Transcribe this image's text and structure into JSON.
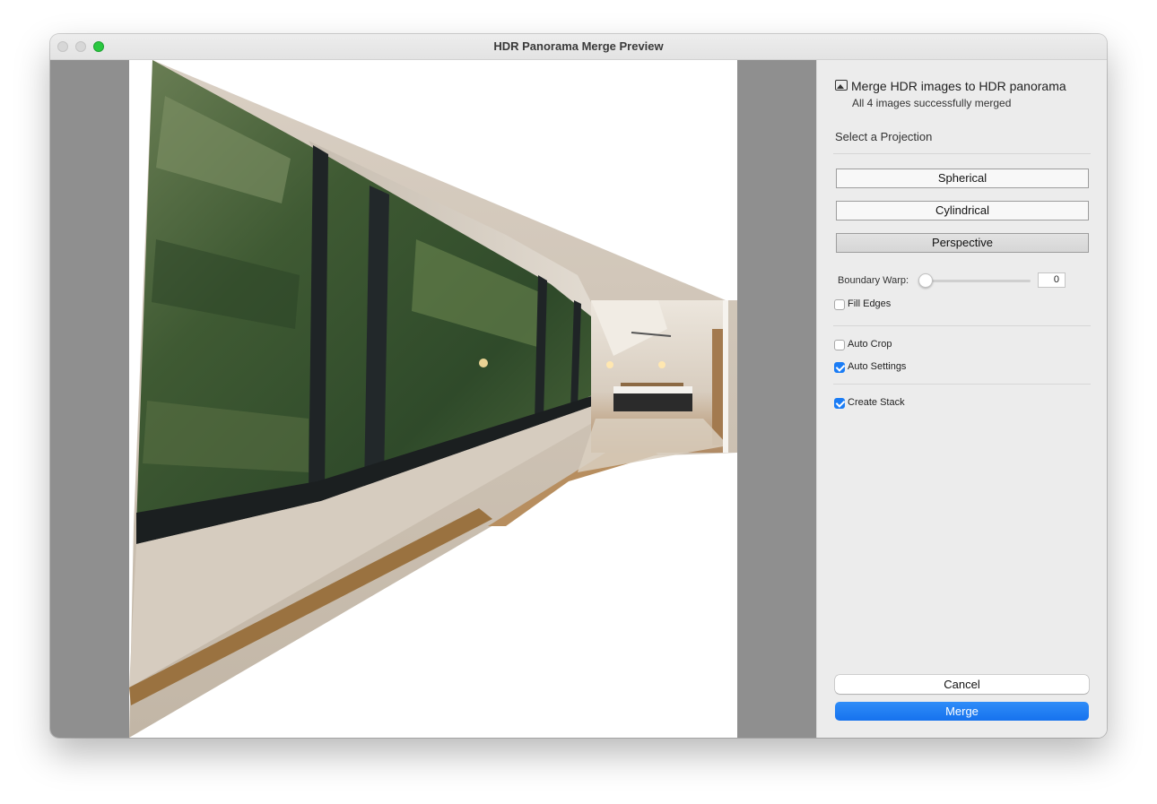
{
  "window": {
    "title": "HDR Panorama Merge Preview"
  },
  "panel": {
    "header_title": "Merge HDR images to HDR panorama",
    "header_subtitle": "All 4 images successfully merged",
    "projection_label": "Select a Projection",
    "projections": [
      {
        "label": "Spherical",
        "selected": false
      },
      {
        "label": "Cylindrical",
        "selected": false
      },
      {
        "label": "Perspective",
        "selected": true
      }
    ],
    "boundary_warp": {
      "label": "Boundary Warp:",
      "value": "0"
    },
    "fill_edges": {
      "label": "Fill Edges",
      "checked": false
    },
    "auto_crop": {
      "label": "Auto Crop",
      "checked": false
    },
    "auto_settings": {
      "label": "Auto Settings",
      "checked": true
    },
    "create_stack": {
      "label": "Create Stack",
      "checked": true
    },
    "cancel_label": "Cancel",
    "merge_label": "Merge"
  },
  "colors": {
    "accent": "#1a7cf5",
    "preview_bg": "#8f8f8f",
    "zoom_button": "#2ac840"
  }
}
